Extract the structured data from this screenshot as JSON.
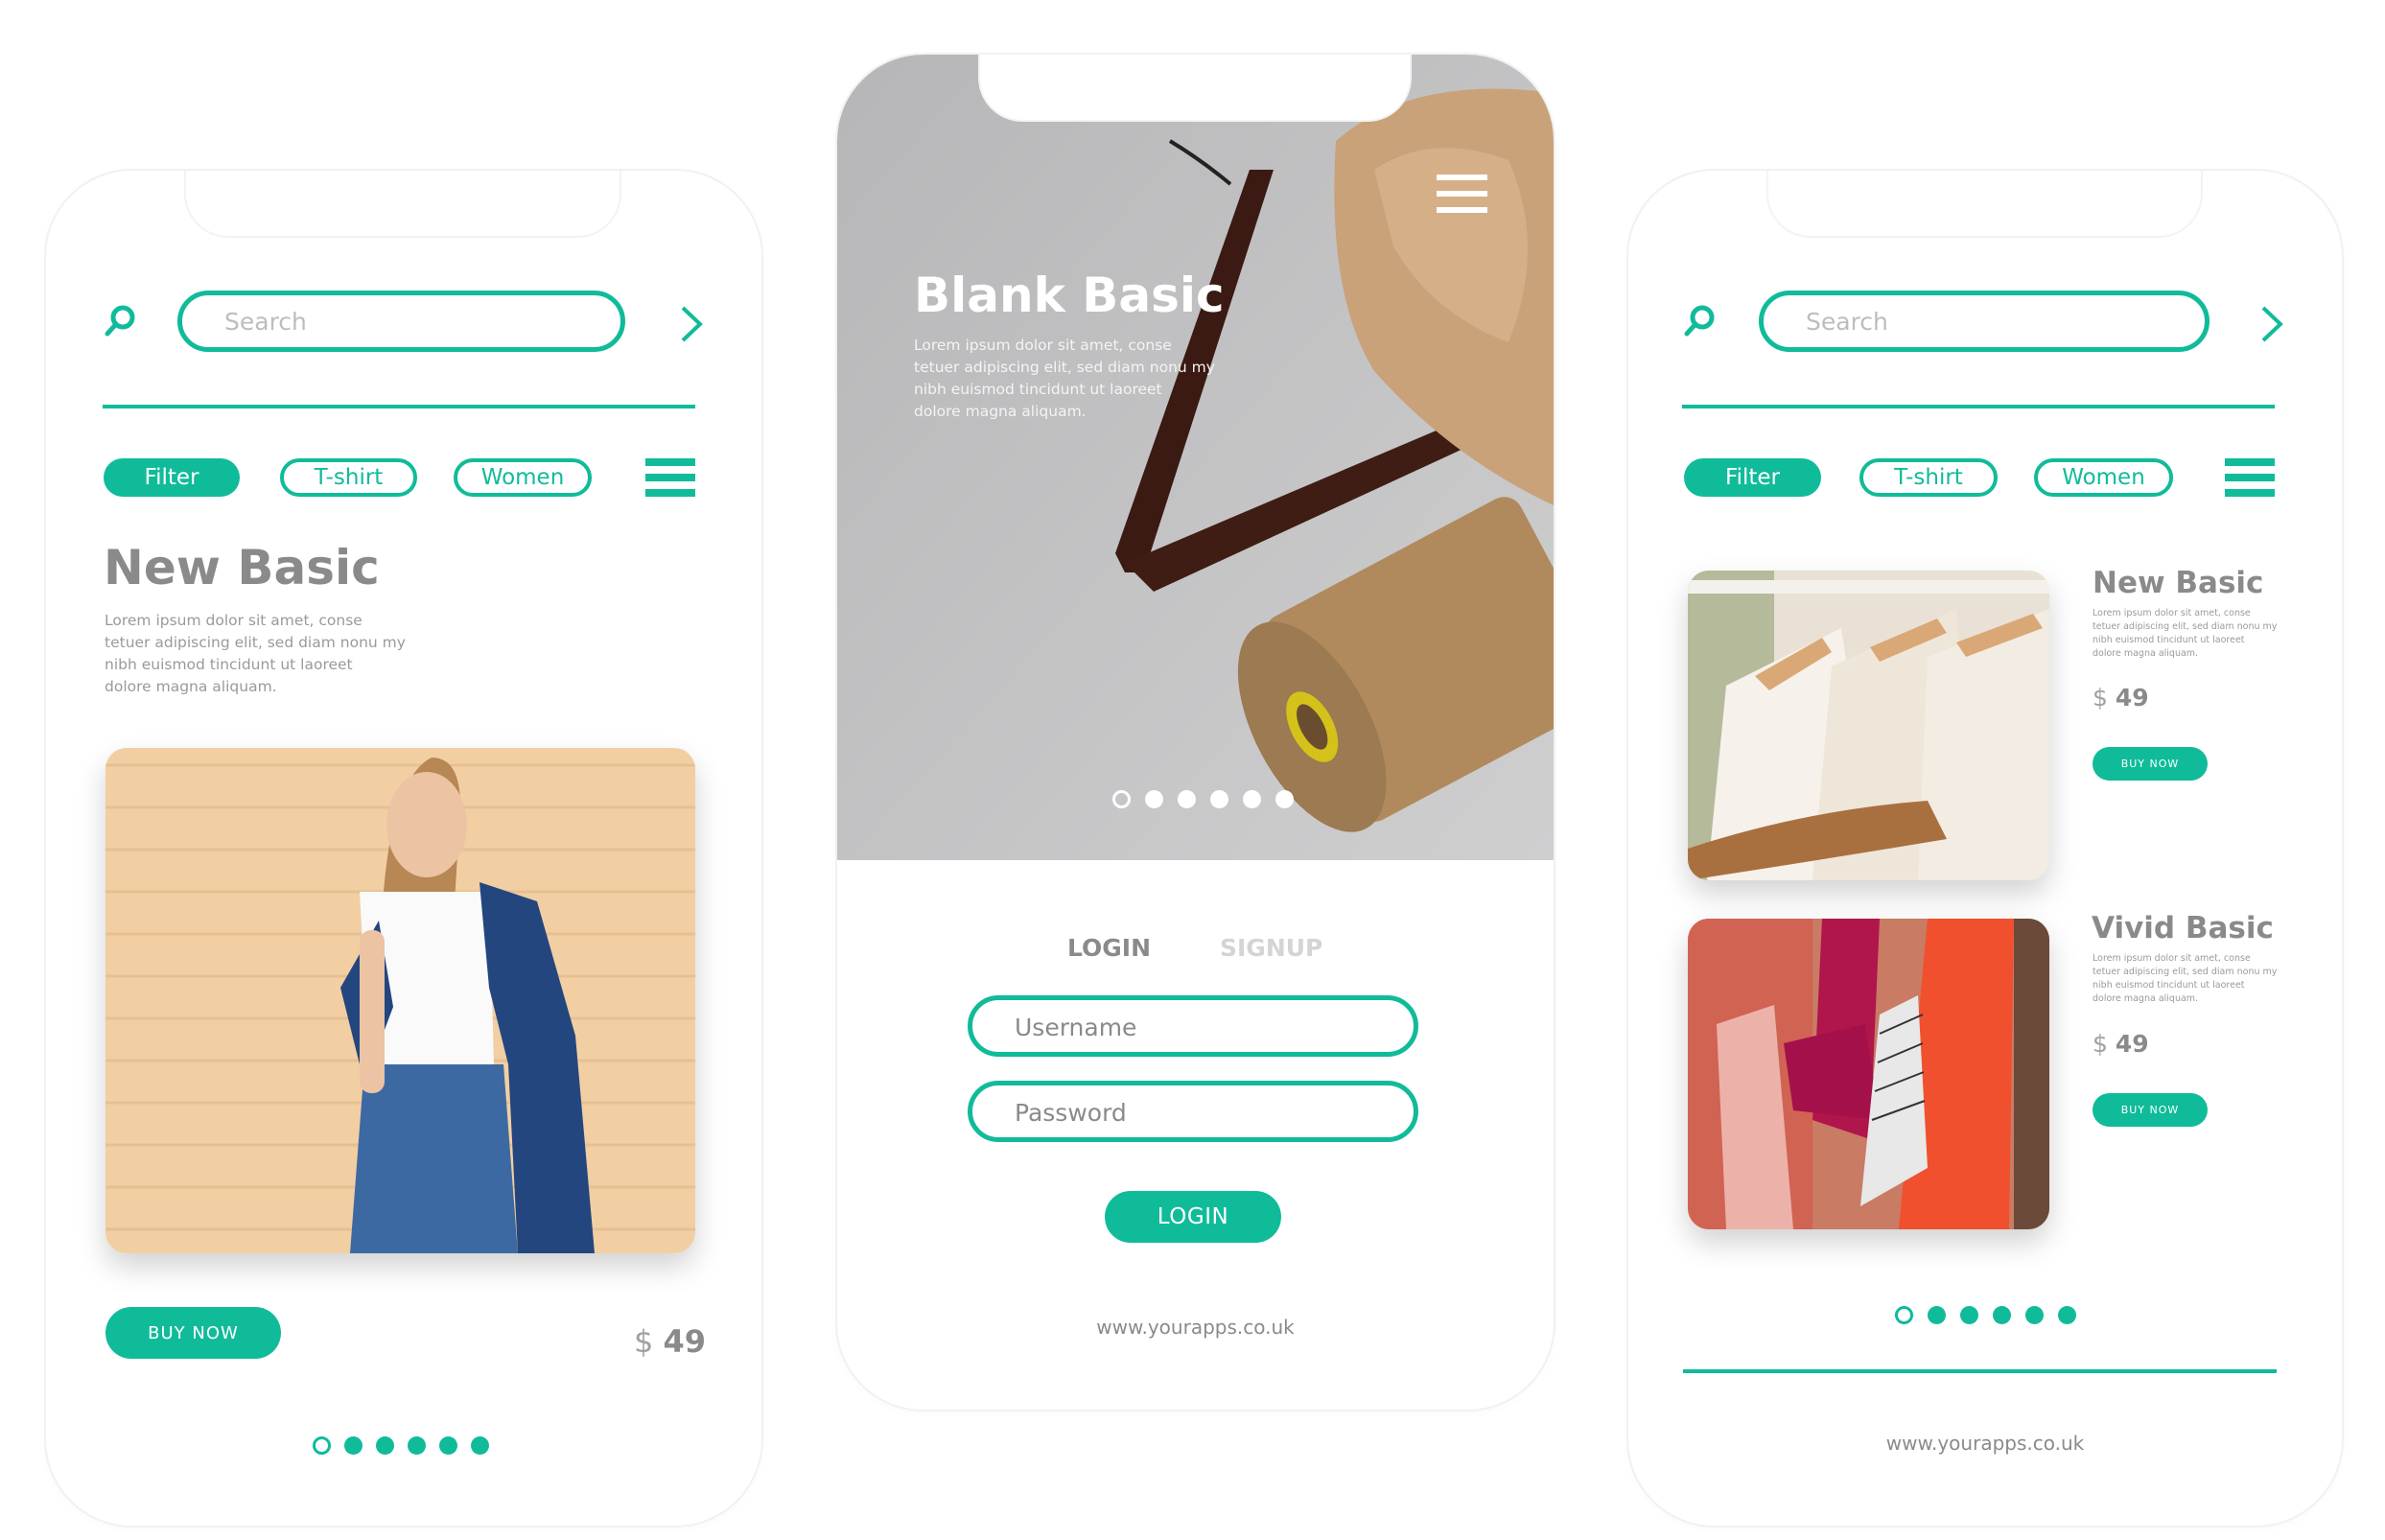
{
  "colors": {
    "accent": "#10bb9a",
    "title_gray": "#8a8a8a",
    "text_gray": "#9a9a9a"
  },
  "left_screen": {
    "search": {
      "placeholder": "Search",
      "icon": "search-icon",
      "go_icon": "chevron-right-icon"
    },
    "chips": [
      {
        "label": "Filter",
        "active": true
      },
      {
        "label": "T-shirt",
        "active": false
      },
      {
        "label": "Women",
        "active": false
      }
    ],
    "menu_icon": "hamburger-menu-icon",
    "product": {
      "title": "New Basic",
      "description": "Lorem ipsum dolor sit amet, conse\ntetuer adipiscing elit, sed diam nonu my\nnibh euismod tincidunt ut laoreet\ndolore magna aliquam.",
      "image": "woman in white t-shirt and denim jacket against beige brick wall",
      "buy_label": "BUY NOW",
      "currency": "$",
      "price": "49"
    },
    "pagination": {
      "total": 6,
      "current": 1
    }
  },
  "center_screen": {
    "hero": {
      "title": "Blank Basic",
      "description": "Lorem ipsum dolor sit amet, conse\ntetuer adipiscing elit, sed diam nonu my\nnibh euismod tincidunt ut laoreet\ndolore magna aliquam.",
      "image": "wooden hanger, beige fabric and thread spool",
      "menu_icon": "hamburger-menu-icon",
      "pagination": {
        "total": 6,
        "current": 1
      }
    },
    "tabs": [
      {
        "label": "LOGIN",
        "active": true
      },
      {
        "label": "SIGNUP",
        "active": false
      }
    ],
    "username": {
      "placeholder": "Username",
      "value": ""
    },
    "password": {
      "placeholder": "Password",
      "value": ""
    },
    "login_button": "LOGIN",
    "footer_url": "www.yourapps.co.uk"
  },
  "right_screen": {
    "search": {
      "placeholder": "Search",
      "icon": "search-icon",
      "go_icon": "chevron-right-icon"
    },
    "chips": [
      {
        "label": "Filter",
        "active": true
      },
      {
        "label": "T-shirt",
        "active": false
      },
      {
        "label": "Women",
        "active": false
      }
    ],
    "menu_icon": "hamburger-menu-icon",
    "products": [
      {
        "title": "New Basic",
        "description": "Lorem ipsum dolor sit amet, conse\ntetuer adipiscing elit, sed diam nonu my\nnibh euismod tincidunt ut laoreet\ndolore magna aliquam.",
        "image": "white shirts on wooden hangers",
        "currency": "$",
        "price": "49",
        "buy_label": "BUY NOW"
      },
      {
        "title": "Vivid Basic",
        "description": "Lorem ipsum dolor sit amet, conse\ntetuer adipiscing elit, sed diam nonu my\nnibh euismod tincidunt ut laoreet\ndolore magna aliquam.",
        "image": "colorful red and magenta clothes on rack",
        "currency": "$",
        "price": "49",
        "buy_label": "BUY NOW"
      }
    ],
    "pagination": {
      "total": 6,
      "current": 1
    },
    "footer_url": "www.yourapps.co.uk"
  }
}
